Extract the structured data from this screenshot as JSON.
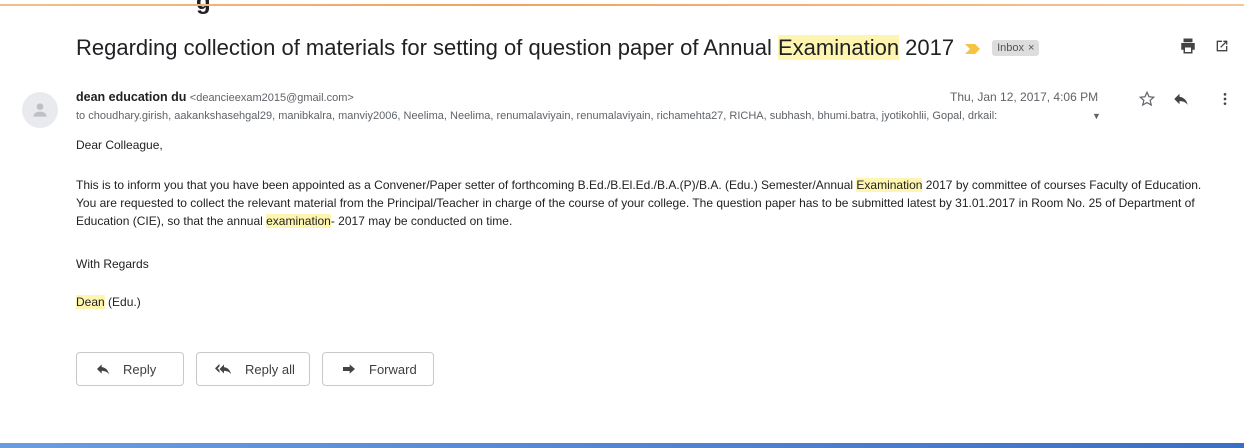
{
  "banner": {
    "text": "g"
  },
  "subject": {
    "before": "Regarding collection of materials for setting of question paper of Annual ",
    "highlight": "Examination",
    "after": " 2017",
    "label": "Inbox",
    "label_close": "×"
  },
  "sender": {
    "name": "dean education du",
    "email": "<deancieexam2015@gmail.com>",
    "date": "Thu, Jan 12, 2017, 4:06 PM",
    "recipients": "to choudhary.girish, aakankshasehgal29, manibkalra, manviy2006, Neelima, Neelima, renumalaviyain, renumalaviyain, richamehta27, RICHA, subhash, bhumi.batra, jyotikohlii, Gopal, drkail:"
  },
  "body": {
    "greeting": "Dear Colleague,",
    "p1_a": "This is to inform you that you have been appointed as a Convener/Paper setter of forthcoming B.Ed./B.El.Ed./B.A.(P)/B.A. (Edu.) Semester/Annual ",
    "p1_hl": "Examination",
    "p1_b": " 2017 by committee of courses Faculty of Education. You are requested to collect the relevant material from the Principal/Teacher in charge of the course of your college. The question paper has to be submitted latest by 31.01.2017 in Room No. 25 of Department of Education (CIE), so that the annual ",
    "p1_hl2": "examination",
    "p1_c": "- 2017 may be conducted on time.",
    "regards": "With Regards",
    "sign_hl": "Dean",
    "sign_rest": " (Edu.)"
  },
  "actions": {
    "reply": "Reply",
    "reply_all": "Reply all",
    "forward": "Forward"
  },
  "icons": {
    "importance": "importance-marker-icon",
    "print": "print-icon",
    "popout": "open-in-new-window-icon",
    "avatar": "default-avatar-icon",
    "star": "star-icon",
    "reply": "reply-icon",
    "more": "more-vert-icon",
    "caret": "caret-down-icon"
  },
  "colors": {
    "highlight": "#fdf5b0",
    "importance": "#f4c342",
    "banner_line": "#f3a25a",
    "bottom_line": "#3b6fc4"
  }
}
